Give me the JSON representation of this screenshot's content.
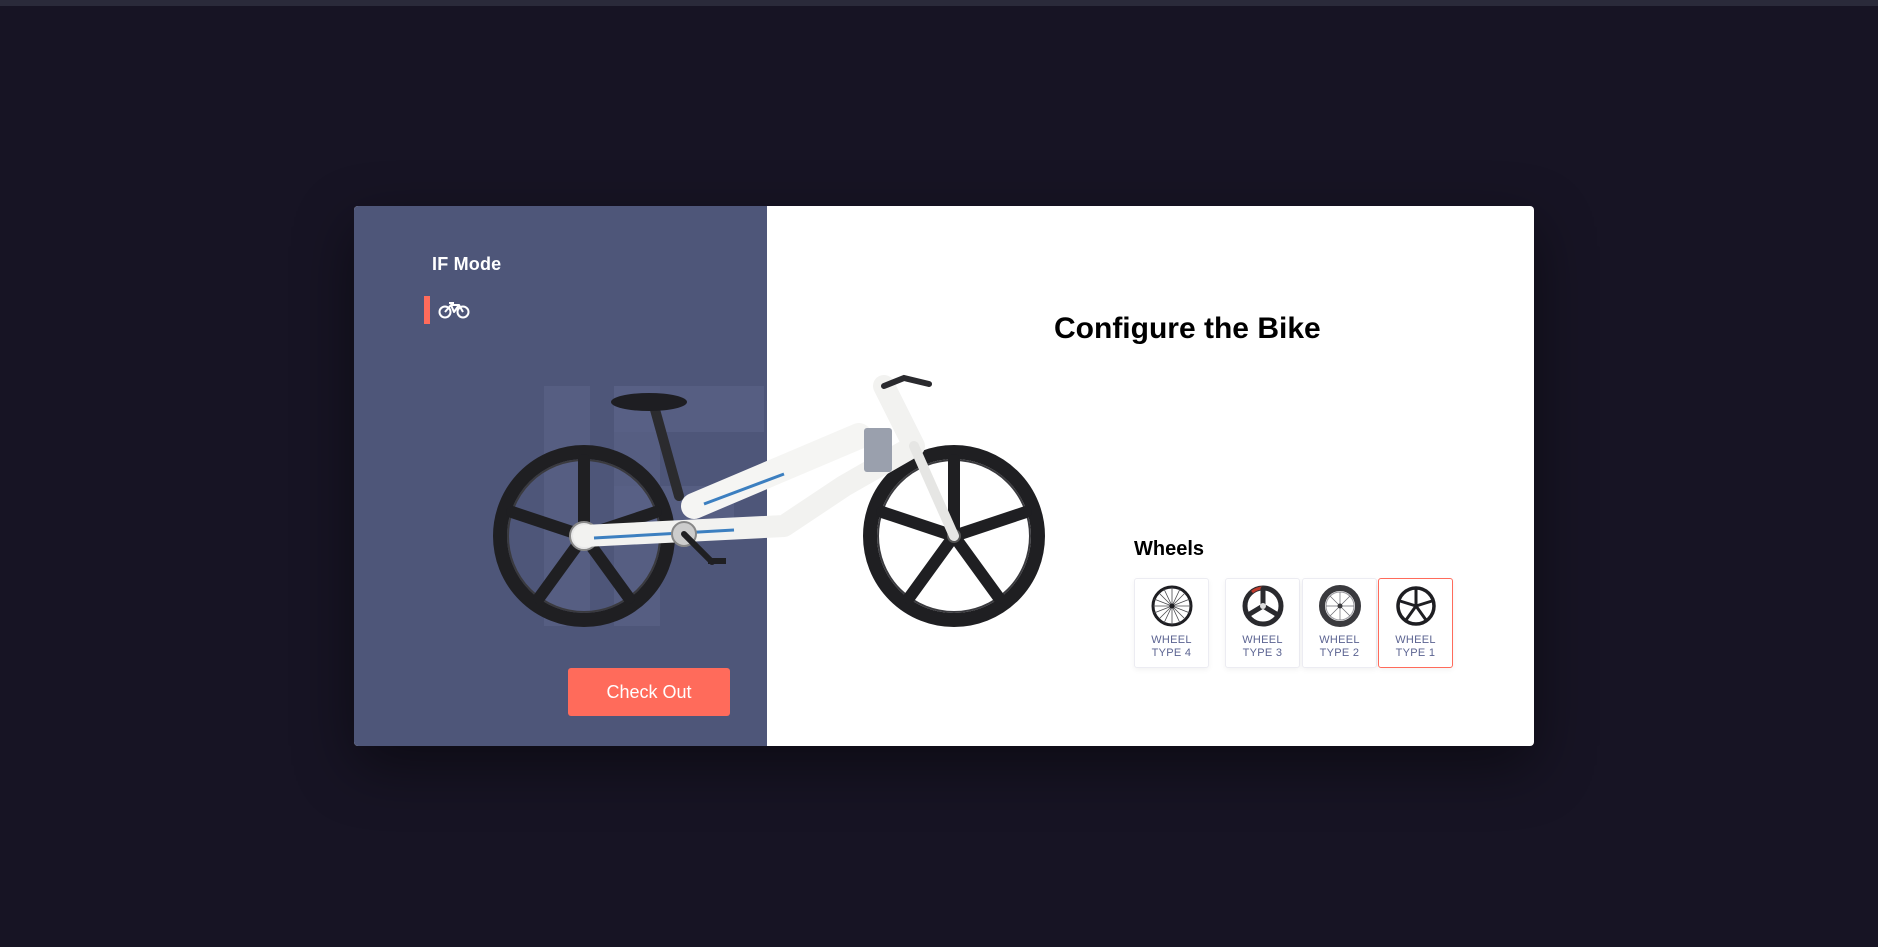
{
  "app": {
    "brand": "IF Mode",
    "mode_icon": "bicycle-icon"
  },
  "panel": {
    "title": "Configure the Bike",
    "wheels_heading": "Wheels",
    "checkout_label": "Check Out"
  },
  "wheels": {
    "options": [
      {
        "label": "WHEEL TYPE 4",
        "icon": "spoked-wheel-icon",
        "selected": false
      },
      {
        "label": "WHEEL TYPE 3",
        "icon": "three-spoke-wheel-icon",
        "selected": false
      },
      {
        "label": "WHEEL TYPE 2",
        "icon": "deep-rim-wheel-icon",
        "selected": false
      },
      {
        "label": "WHEEL TYPE 1",
        "icon": "five-spoke-wheel-icon",
        "selected": true
      }
    ]
  },
  "colors": {
    "page_background": "#171424",
    "left_panel": "#4e5679",
    "accent": "#ff6b5b",
    "option_label": "#5b6391"
  }
}
